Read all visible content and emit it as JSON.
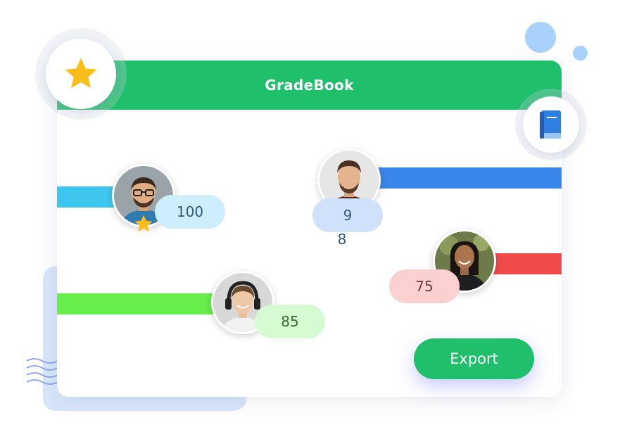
{
  "app": {
    "title": "GradeBook"
  },
  "students": [
    {
      "score": "100"
    },
    {
      "score": "9",
      "score_overflow": "8"
    },
    {
      "score": "75"
    },
    {
      "score": "85"
    }
  ],
  "actions": {
    "export_label": "Export"
  },
  "colors": {
    "header": "#20bf6b",
    "bar_cyan": "#3ec6ee",
    "bar_blue": "#3a86ea",
    "bar_red": "#f04a4a",
    "bar_green": "#66ee4a",
    "star": "#fbbd1a",
    "book": "#2f7fe0"
  },
  "icons": {
    "header_badge": "star-icon",
    "side_badge": "book-icon",
    "student_badge": "star-icon"
  }
}
